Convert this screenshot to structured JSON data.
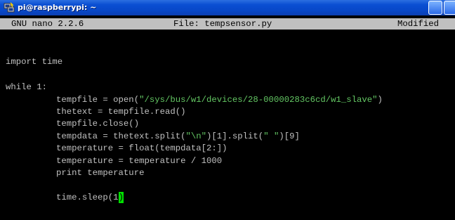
{
  "window": {
    "title": "pi@raspberrypi: ~"
  },
  "nano": {
    "app": "GNU nano 2.2.6",
    "file": "File: tempsensor.py",
    "status": "Modified"
  },
  "code": {
    "l1": "import time",
    "l2": "while 1:",
    "l3a": "tempfile = open(",
    "l3s": "\"/sys/bus/w1/devices/28-00000283c6cd/w1_slave\"",
    "l3b": ")",
    "l4": "thetext = tempfile.read()",
    "l5": "tempfile.close()",
    "l6a": "tempdata = thetext.split(",
    "l6s1": "\"\\n\"",
    "l6b": ")[1].split(",
    "l6s2": "\" \"",
    "l6c": ")[9]",
    "l7": "temperature = float(tempdata[2:])",
    "l8": "temperature = temperature / 1000",
    "l9": "print temperature",
    "l10a": "time.sleep(1",
    "l10c": ")"
  },
  "colors": {
    "titlebar": "#0a4fd3",
    "string": "#63c663",
    "cursor": "#00e000",
    "header_bg": "#c0c0c0",
    "text": "#c0c0c0"
  },
  "icons": {
    "title": "putty-icon"
  }
}
